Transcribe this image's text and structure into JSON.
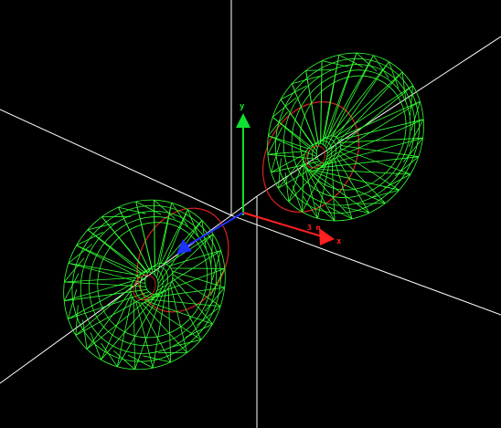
{
  "viewer": {
    "background_color": "#000000",
    "grid_color": "#ffffff",
    "mesh_color": "#33ff33",
    "rim_color": "#dd2222"
  },
  "axes": {
    "x": {
      "label": "x",
      "color": "#ff2020"
    },
    "y": {
      "label": "y",
      "color": "#10e030"
    },
    "z": {
      "color": "#2030ff"
    }
  },
  "annotations": {
    "distance_label": "3 m"
  },
  "meshes": [
    {
      "name": "upper-right-disc",
      "shape": "torus-cone"
    },
    {
      "name": "lower-left-disc",
      "shape": "torus-cone"
    }
  ]
}
